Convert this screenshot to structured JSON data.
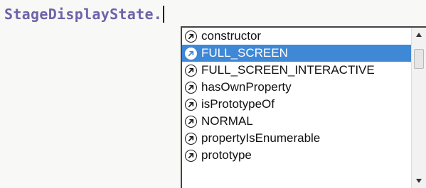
{
  "editor": {
    "code_text": "StageDisplayState."
  },
  "completion": {
    "items": [
      {
        "label": "constructor",
        "icon": "property-icon",
        "selected": false
      },
      {
        "label": "FULL_SCREEN",
        "icon": "property-icon",
        "selected": true
      },
      {
        "label": "FULL_SCREEN_INTERACTIVE",
        "icon": "property-icon",
        "selected": false
      },
      {
        "label": "hasOwnProperty",
        "icon": "property-icon",
        "selected": false
      },
      {
        "label": "isPrototypeOf",
        "icon": "property-icon",
        "selected": false
      },
      {
        "label": "NORMAL",
        "icon": "property-icon",
        "selected": false
      },
      {
        "label": "propertyIsEnumerable",
        "icon": "property-icon",
        "selected": false
      },
      {
        "label": "prototype",
        "icon": "property-icon",
        "selected": false
      }
    ],
    "selection_color": "#3f88d6",
    "scroll_icons": [
      "scroll-up-arrow-icon",
      "scroll-down-arrow-icon"
    ]
  },
  "colors": {
    "code_text": "#6e63a8",
    "background": "#f8f8f6"
  }
}
